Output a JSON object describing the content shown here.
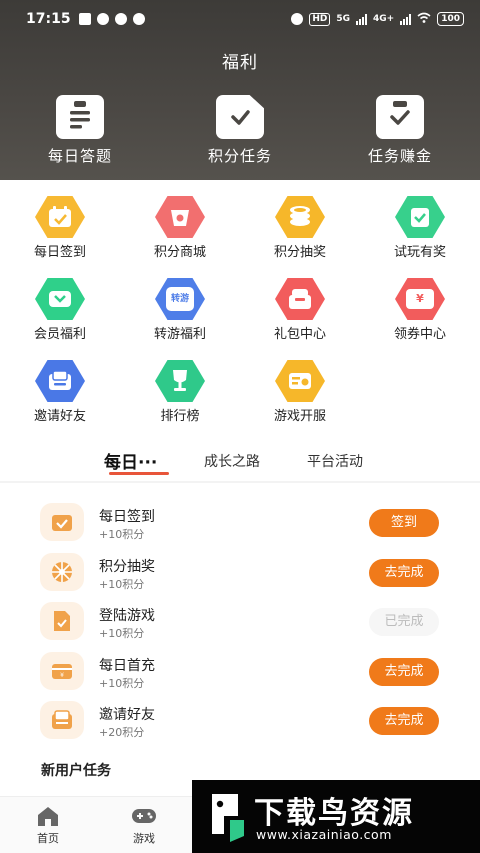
{
  "status_bar": {
    "time": "17:15",
    "hd": "HD",
    "net": "5G",
    "net2": "4G+",
    "battery": "100"
  },
  "title": "福利",
  "top_features": [
    {
      "label": "每日答题",
      "icon": "quiz-clipboard-icon"
    },
    {
      "label": "积分任务",
      "icon": "points-task-document-icon"
    },
    {
      "label": "任务赚金",
      "icon": "task-earn-clipboard-icon"
    }
  ],
  "grid": [
    {
      "label": "每日签到",
      "icon": "calendar-checkin-icon",
      "color": "#f7b932"
    },
    {
      "label": "积分商城",
      "icon": "points-mall-icon",
      "color": "#f26f6f"
    },
    {
      "label": "积分抽奖",
      "icon": "coin-stack-icon",
      "color": "#f6b72a"
    },
    {
      "label": "试玩有奖",
      "icon": "trial-reward-icon",
      "color": "#37d08c"
    },
    {
      "label": "会员福利",
      "icon": "member-gift-icon",
      "color": "#2fd08a"
    },
    {
      "label": "转游福利",
      "icon": "transfer-game-icon",
      "color": "#4f7ee8",
      "badge": "转游"
    },
    {
      "label": "礼包中心",
      "icon": "gift-box-icon",
      "color": "#f25c5c"
    },
    {
      "label": "领券中心",
      "icon": "coupon-icon",
      "color": "#f25c5c",
      "badge": "¥"
    },
    {
      "label": "邀请好友",
      "icon": "invite-envelope-icon",
      "color": "#4a78e6"
    },
    {
      "label": "排行榜",
      "icon": "trophy-icon",
      "color": "#2fc98a"
    },
    {
      "label": "游戏开服",
      "icon": "server-open-icon",
      "color": "#f6b72a"
    }
  ],
  "tabs": [
    {
      "label": "每日···"
    },
    {
      "label": "成长之路"
    },
    {
      "label": "平台活动"
    }
  ],
  "tasks": [
    {
      "title": "每日签到",
      "points": "+10积分",
      "button": "签到",
      "status": "active",
      "icon": "checkin-calendar-icon"
    },
    {
      "title": "积分抽奖",
      "points": "+10积分",
      "button": "去完成",
      "status": "active",
      "icon": "lottery-wheel-icon"
    },
    {
      "title": "登陆游戏",
      "points": "+10积分",
      "button": "已完成",
      "status": "done",
      "icon": "login-game-icon"
    },
    {
      "title": "每日首充",
      "points": "+10积分",
      "button": "去完成",
      "status": "active",
      "icon": "recharge-card-icon"
    },
    {
      "title": "邀请好友",
      "points": "+20积分",
      "button": "去完成",
      "status": "active",
      "icon": "invite-mail-icon"
    }
  ],
  "new_user_label": "新用户任务",
  "bottom_nav": [
    {
      "label": "首页",
      "icon": "home-icon"
    },
    {
      "label": "游戏",
      "icon": "gamepad-icon"
    }
  ],
  "watermark": {
    "title": "下载鸟资源",
    "url": "www.xiazainiao.com"
  },
  "colors": {
    "accent": "#f07a1a",
    "tab_indicator": "#e8553a",
    "header": "#45423e"
  }
}
